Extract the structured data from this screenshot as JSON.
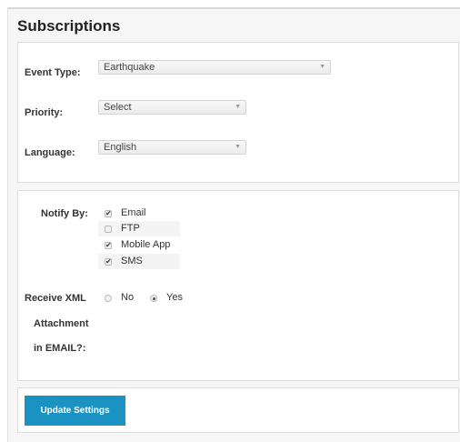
{
  "page": {
    "title": "Subscriptions"
  },
  "settings": {
    "event_type": {
      "label": "Event Type:",
      "value": "Earthquake"
    },
    "priority": {
      "label": "Priority:",
      "value": "Select"
    },
    "language": {
      "label": "Language:",
      "value": "English"
    }
  },
  "notify": {
    "label": "Notify By:",
    "options": [
      {
        "label": "Email",
        "checked": true
      },
      {
        "label": "FTP",
        "checked": false
      },
      {
        "label": "Mobile App",
        "checked": true
      },
      {
        "label": "SMS",
        "checked": true
      }
    ]
  },
  "xml_attachment": {
    "label_line1": "Receive XML",
    "label_line2": "Attachment",
    "label_line3": "in EMAIL?:",
    "options": [
      {
        "label": "No",
        "selected": false
      },
      {
        "label": "Yes",
        "selected": true
      }
    ]
  },
  "actions": {
    "update_label": "Update Settings"
  },
  "colors": {
    "button_bg": "#1a93c2"
  }
}
